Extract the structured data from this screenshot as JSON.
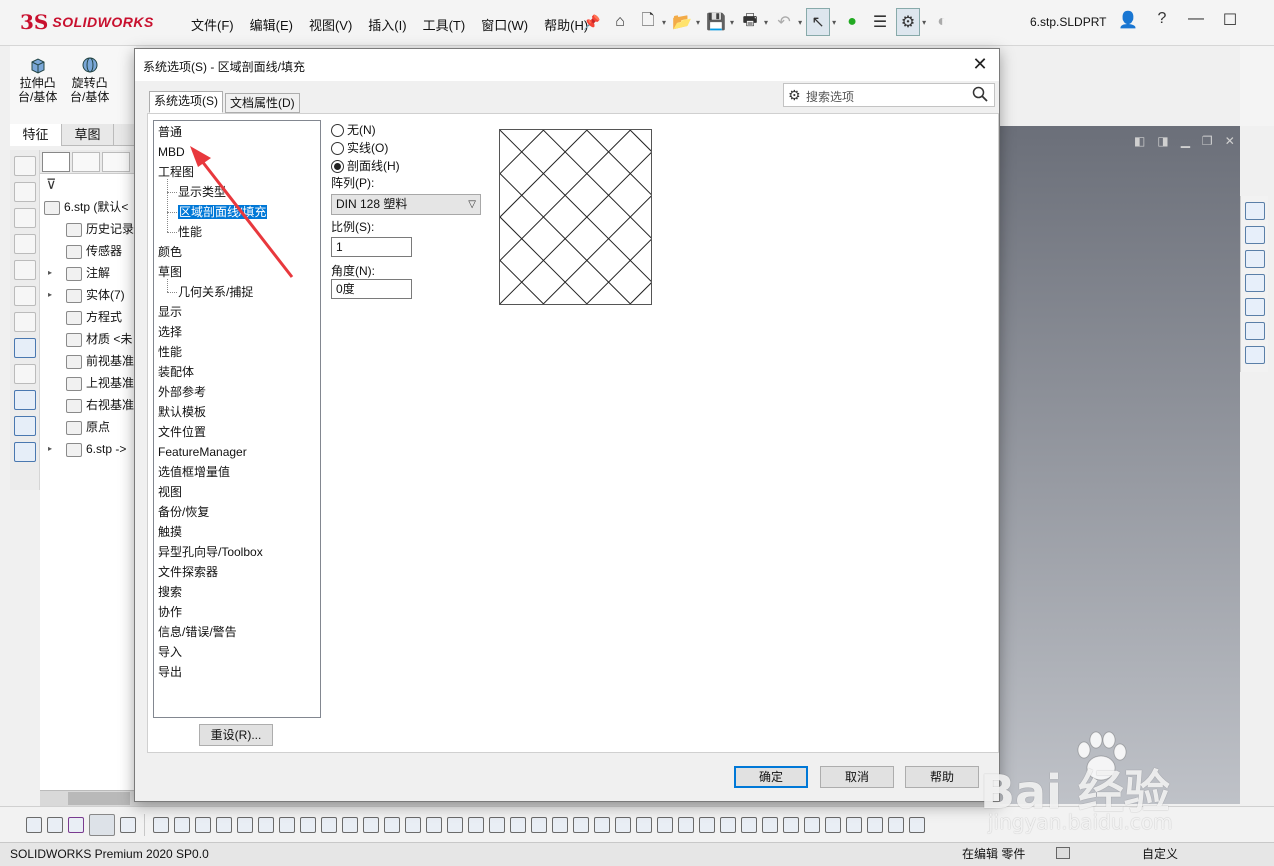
{
  "app": {
    "logo_ds": "3S",
    "logo_text": "SOLIDWORKS",
    "doc_title": "6.stp.SLDPRT",
    "menu": [
      "文件(F)",
      "编辑(E)",
      "视图(V)",
      "插入(I)",
      "工具(T)",
      "窗口(W)",
      "帮助(H)"
    ],
    "window_controls": {
      "user": "👤",
      "help": "?",
      "minimize": "—",
      "maximize": "☐"
    }
  },
  "ribbon": {
    "extrude_label": "拉伸凸\n台/基体",
    "revolve_label": "旋转凸\n台/基体"
  },
  "command_tabs": [
    "特征",
    "草图"
  ],
  "feature_tree": {
    "items": [
      {
        "label": "6.stp  (默认<",
        "indent": 0
      },
      {
        "label": "历史记录",
        "indent": 1
      },
      {
        "label": "传感器",
        "indent": 1
      },
      {
        "label": "注解",
        "indent": 1,
        "expandable": true
      },
      {
        "label": "实体(7)",
        "indent": 1,
        "expandable": true
      },
      {
        "label": "方程式",
        "indent": 1
      },
      {
        "label": "材质 <未",
        "indent": 1
      },
      {
        "label": "前视基准",
        "indent": 1
      },
      {
        "label": "上视基准",
        "indent": 1
      },
      {
        "label": "右视基准",
        "indent": 1
      },
      {
        "label": "原点",
        "indent": 1
      },
      {
        "label": "6.stp ->",
        "indent": 1,
        "expandable": true
      }
    ]
  },
  "dialog": {
    "title": "系统选项(S) - 区域剖面线/填充",
    "close": "✕",
    "tabs": [
      {
        "label": "系统选项(S)",
        "active": true
      },
      {
        "label": "文档属性(D)",
        "active": false
      }
    ],
    "search_placeholder": "搜索选项",
    "options": [
      {
        "label": "普通",
        "level": 0
      },
      {
        "label": "MBD",
        "level": 0
      },
      {
        "label": "工程图",
        "level": 0
      },
      {
        "label": "显示类型",
        "level": 1
      },
      {
        "label": "区域剖面线/填充",
        "level": 1,
        "selected": true
      },
      {
        "label": "性能",
        "level": 1
      },
      {
        "label": "颜色",
        "level": 0
      },
      {
        "label": "草图",
        "level": 0
      },
      {
        "label": "几何关系/捕捉",
        "level": 1
      },
      {
        "label": "显示",
        "level": 0
      },
      {
        "label": "选择",
        "level": 0
      },
      {
        "label": "性能",
        "level": 0
      },
      {
        "label": "装配体",
        "level": 0
      },
      {
        "label": "外部参考",
        "level": 0
      },
      {
        "label": "默认模板",
        "level": 0
      },
      {
        "label": "文件位置",
        "level": 0
      },
      {
        "label": "FeatureManager",
        "level": 0
      },
      {
        "label": "选值框增量值",
        "level": 0
      },
      {
        "label": "视图",
        "level": 0
      },
      {
        "label": "备份/恢复",
        "level": 0
      },
      {
        "label": "触摸",
        "level": 0
      },
      {
        "label": "异型孔向导/Toolbox",
        "level": 0
      },
      {
        "label": "文件探索器",
        "level": 0
      },
      {
        "label": "搜索",
        "level": 0
      },
      {
        "label": "协作",
        "level": 0
      },
      {
        "label": "信息/错误/警告",
        "level": 0
      },
      {
        "label": "导入",
        "level": 0
      },
      {
        "label": "导出",
        "level": 0
      }
    ],
    "radio_none": "无(N)",
    "radio_solid": "实线(O)",
    "radio_hatch": "剖面线(H)",
    "selected_radio": "hatch",
    "pattern_label": "阵列(P):",
    "pattern_value": "DIN 128 塑料",
    "scale_label": "比例(S):",
    "scale_value": "1",
    "angle_label": "角度(N):",
    "angle_value": "0度",
    "reset_button": "重设(R)...",
    "ok_button": "确定",
    "cancel_button": "取消",
    "help_button": "帮助"
  },
  "statusbar": {
    "product": "SOLIDWORKS Premium 2020 SP0.0",
    "mode": "在编辑 零件",
    "units": "自定义"
  },
  "watermark": {
    "brand": "Bai 经验",
    "url": "jingyan.baidu.com"
  },
  "colors": {
    "brand_red": "#c8102e",
    "selection_blue": "#0078d7",
    "annotation_arrow": "#e8383d"
  }
}
